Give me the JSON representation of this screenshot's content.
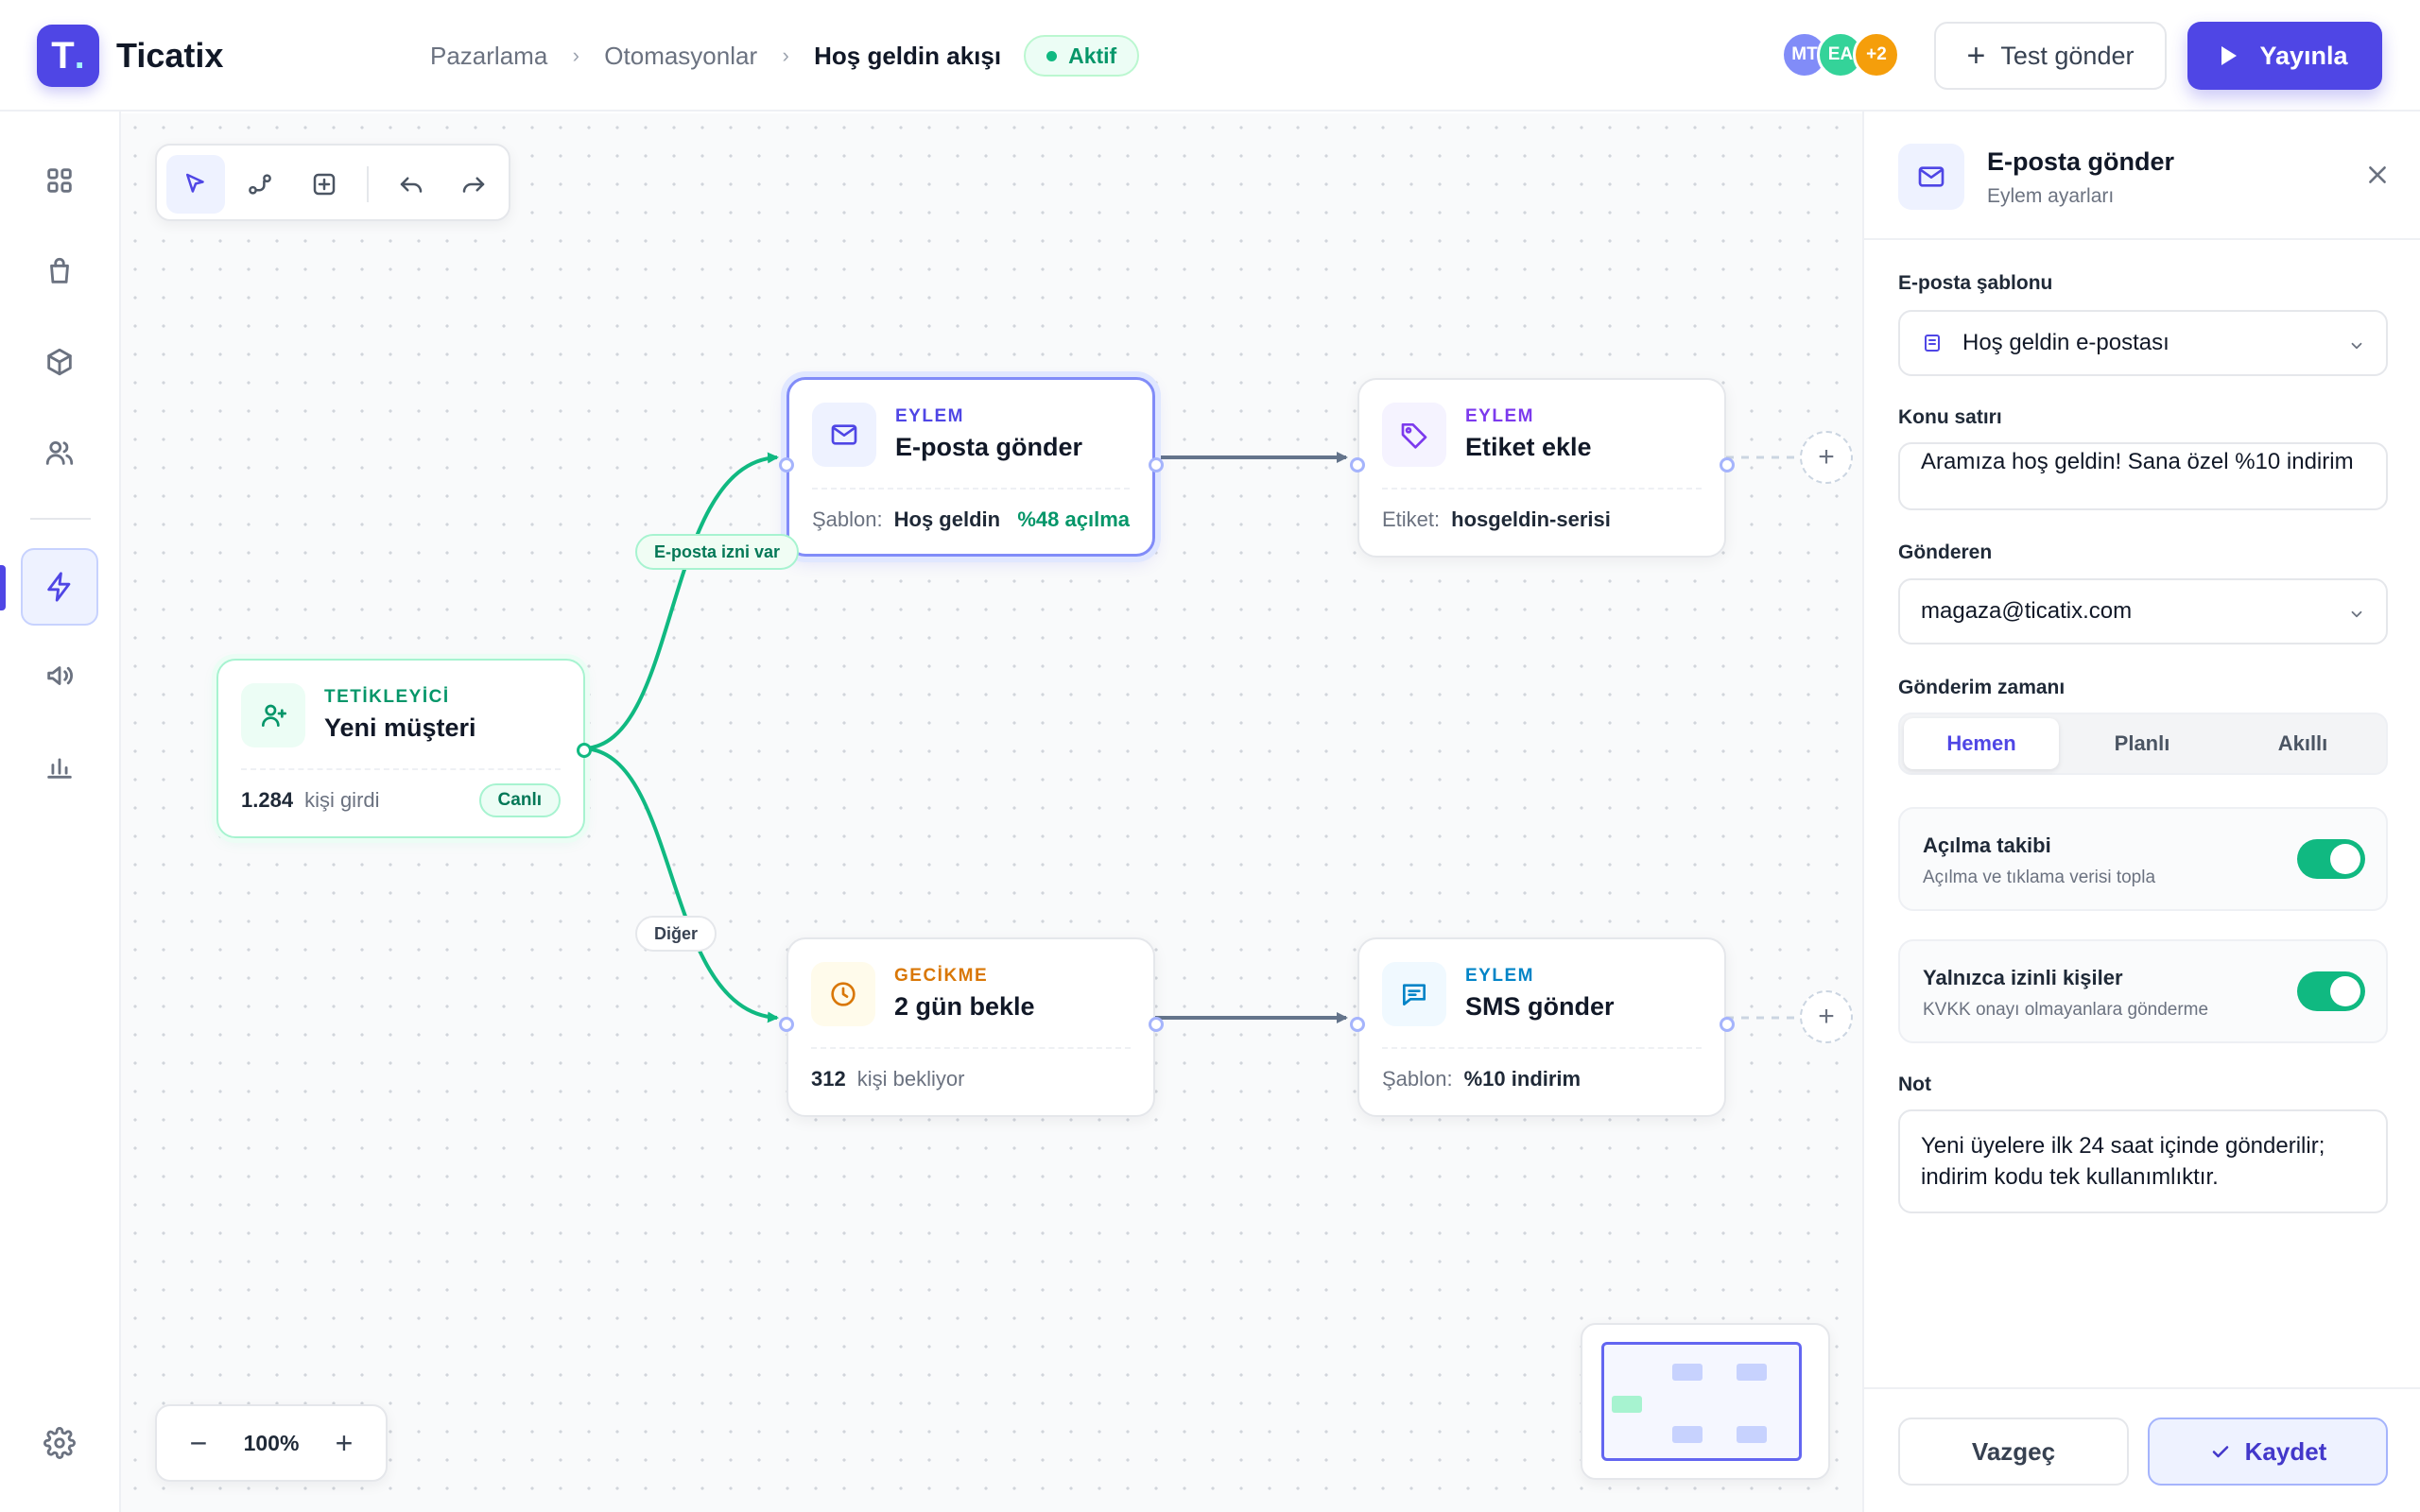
{
  "app": {
    "name": "Ticatix",
    "logo_letter": "T"
  },
  "breadcrumb": {
    "items": [
      "Pazarlama",
      "Otomasyonlar"
    ],
    "current": "Hoş geldin akışı",
    "status": "Aktif"
  },
  "collaborators": [
    {
      "initials": "MT",
      "color": "#818cf8"
    },
    {
      "initials": "EA",
      "color": "#34d399"
    },
    {
      "initials": "+2",
      "color": "#f59e0b"
    }
  ],
  "header_actions": {
    "test_label": "Test gönder",
    "publish_label": "Yayınla"
  },
  "sidebar": {
    "items": [
      {
        "name": "dashboard",
        "icon": "grid-icon"
      },
      {
        "name": "orders",
        "icon": "shopping-bag-icon"
      },
      {
        "name": "products",
        "icon": "box-icon"
      },
      {
        "name": "customers",
        "icon": "users-icon"
      },
      {
        "name": "automations",
        "icon": "lightning-icon",
        "active": true
      },
      {
        "name": "campaigns",
        "icon": "megaphone-icon"
      },
      {
        "name": "reports",
        "icon": "bar-chart-icon"
      }
    ],
    "settings_icon": "gear-icon"
  },
  "canvas": {
    "tools": [
      "pointer-icon",
      "connect-icon",
      "add-node-icon",
      "undo-icon",
      "redo-icon"
    ],
    "zoom": "100%",
    "nodes": {
      "trigger": {
        "type": "TETİKLEYİCİ",
        "title": "Yeni müşteri",
        "count": "1.284",
        "count_label": "kişi girdi",
        "badge": "Canlı"
      },
      "email": {
        "type": "EYLEM",
        "title": "E-posta gönder",
        "key": "Şablon:",
        "value": "Hoş geldin",
        "metric": "%48 açılma"
      },
      "tag": {
        "type": "EYLEM",
        "title": "Etiket ekle",
        "key": "Etiket:",
        "value": "hosgeldin-serisi"
      },
      "delay": {
        "type": "GECİKME",
        "title": "2 gün bekle",
        "count": "312",
        "count_label": "kişi bekliyor"
      },
      "sms": {
        "type": "EYLEM",
        "title": "SMS gönder",
        "key": "Şablon:",
        "value": "%10 indirim"
      }
    },
    "edge_labels": {
      "yes": "E-posta izni var",
      "other": "Diğer"
    },
    "colors": {
      "accent": "#4f46e5",
      "success": "#10b981",
      "warning": "#d97706",
      "sky": "#0284c7",
      "purple": "#7c3aed"
    }
  },
  "panel": {
    "title": "E-posta gönder",
    "subtitle": "Eylem ayarları",
    "template": {
      "label": "E-posta şablonu",
      "value": "Hoş geldin e-postası"
    },
    "subject": {
      "label": "Konu satırı",
      "value": "Aramıza hoş geldin! Sana özel %10 indirim"
    },
    "sender": {
      "label": "Gönderen",
      "value": "magaza@ticatix.com"
    },
    "timing": {
      "label": "Gönderim zamanı",
      "options": [
        "Hemen",
        "Planlı",
        "Akıllı"
      ],
      "selected": "Hemen"
    },
    "toggles": [
      {
        "title": "Açılma takibi",
        "subtitle": "Açılma ve tıklama verisi topla",
        "on": true
      },
      {
        "title": "Yalnızca izinli kişiler",
        "subtitle": "KVKK onayı olmayanlara gönderme",
        "on": true
      }
    ],
    "note": {
      "label": "Not",
      "value": "Yeni üyelere ilk 24 saat içinde gönderilir; indirim kodu tek kullanımlıktır."
    },
    "cancel_label": "Vazgeç",
    "save_label": "Kaydet"
  }
}
